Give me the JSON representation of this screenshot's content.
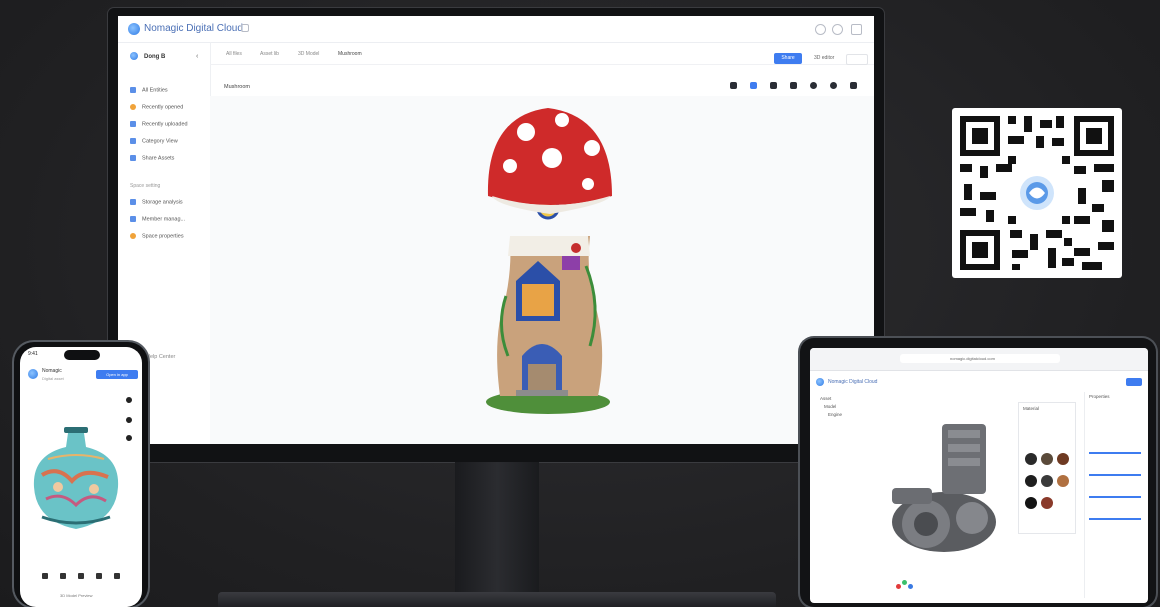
{
  "monitor": {
    "app_title": "Nomagic Digital Cloud",
    "sidebar": {
      "workspace": "Dong B",
      "items": [
        {
          "label": "All Entities",
          "icon": "folder-icon",
          "color": "#5b8fe8"
        },
        {
          "label": "Recently opened",
          "icon": "clock-icon",
          "color": "#f0a33a"
        },
        {
          "label": "Recently uploaded",
          "icon": "upload-icon",
          "color": "#5b8fe8"
        },
        {
          "label": "Category View",
          "icon": "grid-icon",
          "color": "#5b8fe8"
        },
        {
          "label": "Share Assets",
          "icon": "share-icon",
          "color": "#5b8fe8"
        }
      ],
      "section_label": "Space setting",
      "section_items": [
        {
          "label": "Storage analysis",
          "icon": "chart-icon",
          "color": "#5b8fe8"
        },
        {
          "label": "Member manag...",
          "icon": "users-icon",
          "color": "#5b8fe8"
        },
        {
          "label": "Space properties",
          "icon": "gear-icon",
          "color": "#f0a33a"
        }
      ],
      "footer": "Help Center"
    },
    "breadcrumbs": [
      "All files",
      "Asset lib",
      "3D Model",
      "Mushroom"
    ],
    "share_label": "Share",
    "other_action": "3D editor",
    "viewer_title": "Mushroom"
  },
  "phone": {
    "title": "Nomagic",
    "subtitle": "Digital asset",
    "action_label": "Open in app",
    "bottom_label": "3D Model Preview"
  },
  "tablet": {
    "url": "nomagic.digitalcloud.com",
    "title": "Nomagic Digital Cloud",
    "tree": [
      "Asset",
      "Model",
      "Engine"
    ],
    "panel_title": "Material",
    "props_title": "Properties"
  },
  "colors": {
    "accent": "#3e7cf0",
    "mushroom_cap": "#cf2a2a"
  }
}
